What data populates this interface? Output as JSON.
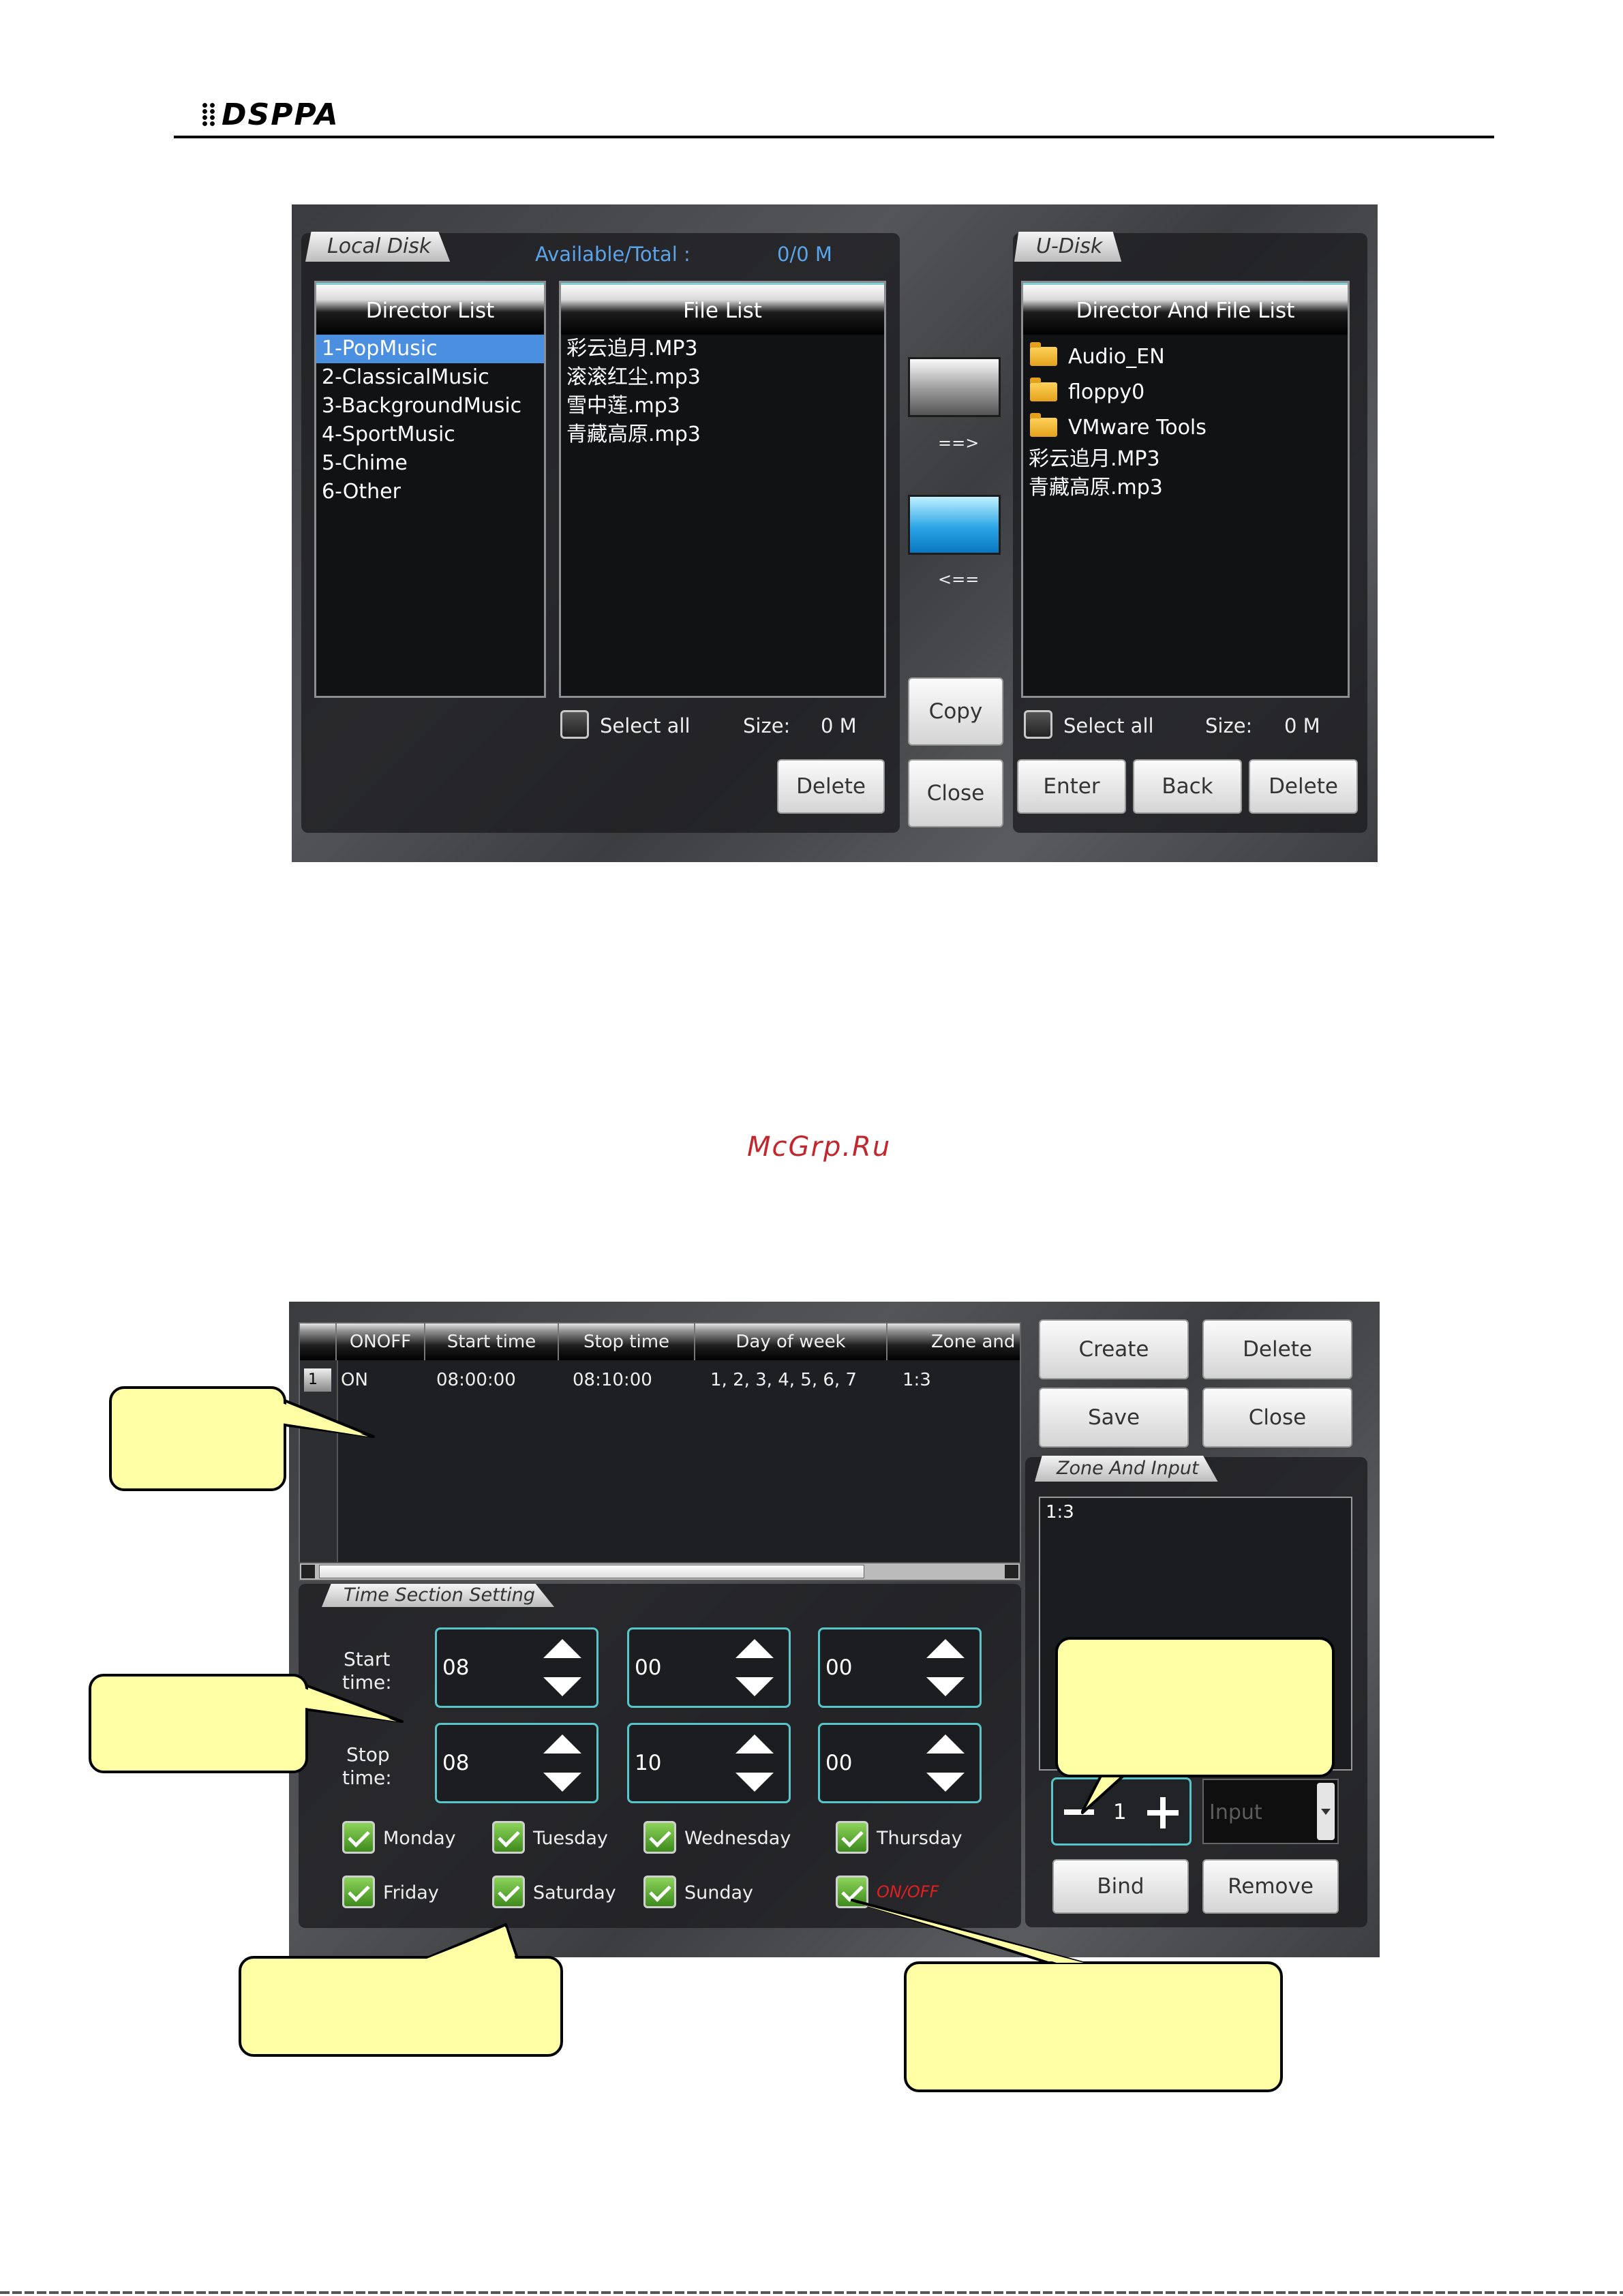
{
  "header": {
    "logo_text": "DSPPA"
  },
  "watermark": "McGrp.Ru",
  "screen1": {
    "local_disk": {
      "tab_label": "Local Disk",
      "available_label": "Available/Total :",
      "available_value": "0/0 M",
      "director_list": {
        "header": "Director List",
        "items": [
          "1-PopMusic",
          "2-ClassicalMusic",
          "3-BackgroundMusic",
          "4-SportMusic",
          "5-Chime",
          "6-Other"
        ],
        "selected_index": 0
      },
      "file_list": {
        "header": "File List",
        "items": [
          "彩云追月.MP3",
          "滚滚红尘.mp3",
          "雪中莲.mp3",
          "青藏高原.mp3"
        ]
      },
      "select_all_label": "Select all",
      "size_label": "Size:",
      "size_value": "0 M",
      "delete_button": "Delete"
    },
    "middle": {
      "arrow_right_label": "==>",
      "arrow_left_label": "<==",
      "copy_button": "Copy",
      "close_button": "Close"
    },
    "udisk": {
      "tab_label": "U-Disk",
      "list": {
        "header": "Director And File List",
        "folders": [
          "Audio_EN",
          "floppy0",
          "VMware Tools"
        ],
        "files": [
          "彩云追月.MP3",
          "青藏高原.mp3"
        ]
      },
      "select_all_label": "Select all",
      "size_label": "Size:",
      "size_value": "0 M",
      "enter_button": "Enter",
      "back_button": "Back",
      "delete_button": "Delete"
    }
  },
  "screen2": {
    "table": {
      "columns": [
        "ONOFF",
        "Start time",
        "Stop time",
        "Day of week",
        "Zone and"
      ],
      "rows": [
        {
          "index": "1",
          "onoff": "ON",
          "start": "08:00:00",
          "stop": "08:10:00",
          "days": "1, 2, 3, 4, 5, 6, 7",
          "zone": "1:3"
        }
      ]
    },
    "buttons": {
      "create": "Create",
      "delete": "Delete",
      "save": "Save",
      "close": "Close",
      "bind": "Bind",
      "remove": "Remove"
    },
    "zone_input": {
      "tab_label": "Zone And Input",
      "items": [
        "1:3"
      ],
      "stepper_value": "1",
      "input_placeholder": "Input"
    },
    "time_section": {
      "tab_label": "Time Section Setting",
      "start_label_1": "Start",
      "start_label_2": "time:",
      "stop_label_1": "Stop",
      "stop_label_2": "time:",
      "start": [
        "08",
        "00",
        "00"
      ],
      "stop": [
        "08",
        "10",
        "00"
      ],
      "days": [
        "Monday",
        "Tuesday",
        "Wednesday",
        "Thursday",
        "Friday",
        "Saturday",
        "Sunday"
      ],
      "onoff_label": "ON/OFF"
    }
  },
  "colors": {
    "accent_teal": "#57c6c8",
    "selection_blue": "#4a8fe0",
    "callout_yellow": "#ffffa6",
    "onoff_red": "#e02020"
  }
}
